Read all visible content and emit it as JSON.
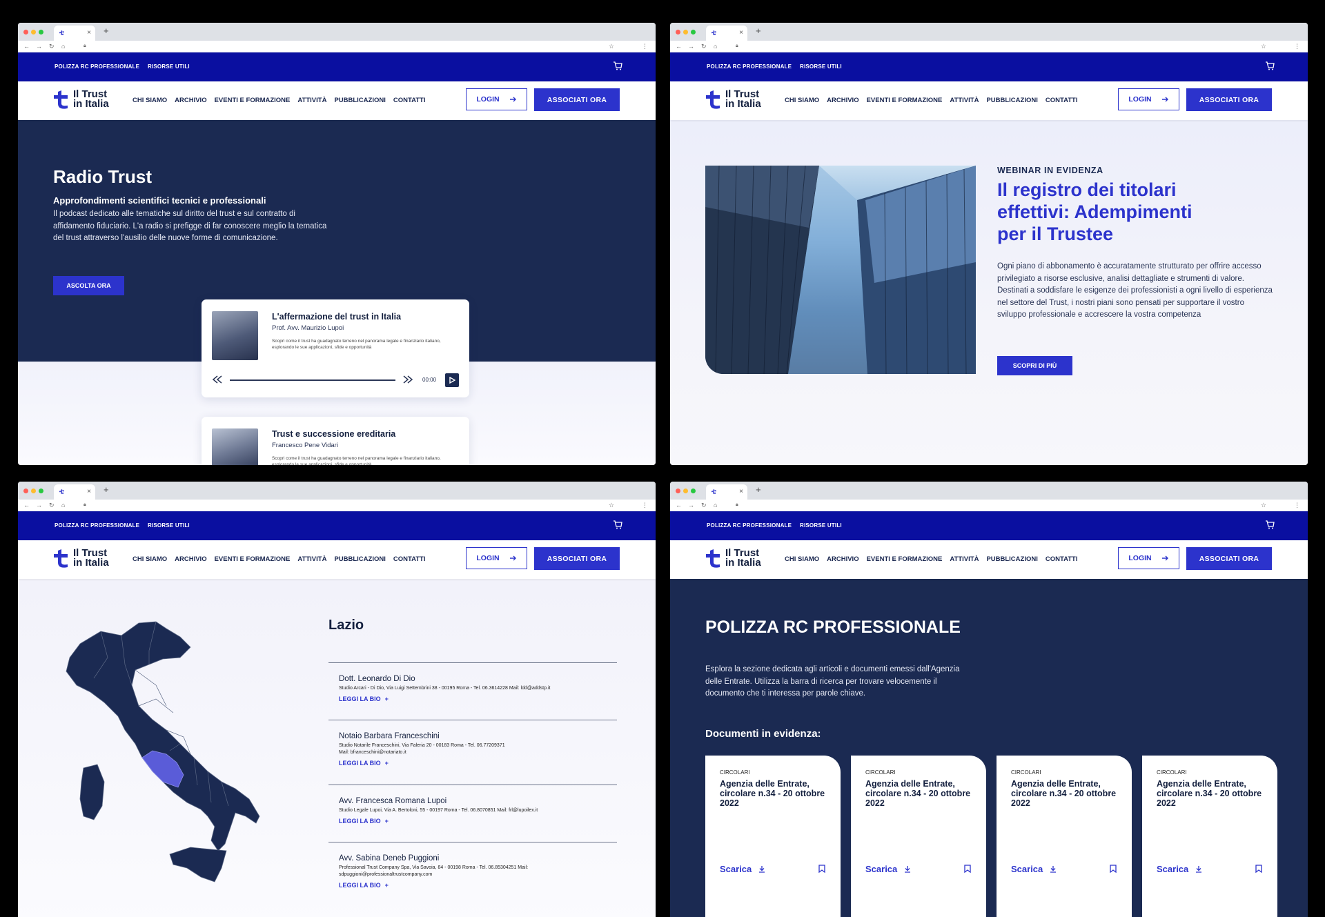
{
  "header": {
    "topbar_links": [
      "POLIZZA RC PROFESSIONALE",
      "RISORSE UTILI"
    ],
    "logo_line1": "Il Trust",
    "logo_line2": "in Italia",
    "nav": [
      "CHI SIAMO",
      "ARCHIVIO",
      "EVENTI E FORMAZIONE",
      "ATTIVITÀ",
      "PUBBLICAZIONI",
      "CONTATTI"
    ],
    "login": "LOGIN",
    "associati": "ASSOCIATI ORA"
  },
  "radio": {
    "title": "Radio Trust",
    "subtitle": "Approfondimenti scientifici tecnici e professionali",
    "description": "Il podcast dedicato alle tematiche sul diritto del trust e sul contratto di affidamento fiduciario. L'a radio si prefigge di far conoscere meglio la tematica del trust attraverso l'ausilio delle nuove forme di comunicazione.",
    "cta": "ASCOLTA ORA",
    "episodes": [
      {
        "title": "L'affermazione del trust in Italia",
        "author": "Prof. Avv. Maurizio Lupoi",
        "description": "Scopri come il trust ha guadagnato terreno nel panorama legale e finanziario italiano, esplorando le sue applicazioni, sfide e opportunità",
        "time": "00:00"
      },
      {
        "title": "Trust e successione ereditaria",
        "author": "Francesco Pene Vidari",
        "description": "Scopri come il trust ha guadagnato terreno nel panorama legale e finanziario italiano, esplorando le sue applicazioni, sfide e opportunità"
      }
    ]
  },
  "webinar": {
    "kicker": "WEBINAR IN EVIDENZA",
    "title": "Il registro dei titolari effettivi: Adempimenti per il Trustee",
    "description": "Ogni piano di abbonamento è accuratamente strutturato per offrire accesso privilegiato a risorse esclusive, analisi dettagliate e strumenti di valore. Destinati a soddisfare le esigenze dei professionisti a ogni livello di esperienza nel settore del Trust, i nostri piani sono pensati per supportare il vostro sviluppo professionale e accrescere la vostra competenza",
    "cta": "SCOPRI DI PIÙ"
  },
  "region": {
    "title": "Lazio",
    "bio_label": "LEGGI LA BIO",
    "contacts": [
      {
        "name": "Dott. Leonardo Di Dio",
        "info": "Studio Arcari - Di Dio, Via Luigi Settembrini 38 - 00195 Roma - Tel. 06.3614228 Mail: ldd@addstp.it"
      },
      {
        "name": "Notaio Barbara Franceschini",
        "info": "Studio Notarile Franceschini, Via Faleria 20 - 00183 Roma - Tel. 06.77209371",
        "info2": "Mail: bfranceschini@notariato.it"
      },
      {
        "name": "Avv. Francesca Romana Lupoi",
        "info": "Studio Legale Lupoi, Via A. Bertoloni, 55 - 00197 Roma - Tel. 06.8070851 Mail: frl@lupoilex.it"
      },
      {
        "name": "Avv. Sabina Deneb Puggioni",
        "info": "Professional Trust Company Spa, Via Savoia, 84 - 00198 Roma - Tel. 06.85304251 Mail:",
        "info2": "sdpuggioni@professionaltrustcompany.com"
      }
    ]
  },
  "polizza": {
    "title": "POLIZZA RC PROFESSIONALE",
    "description": "Esplora la sezione dedicata agli articoli e documenti emessi dall'Agenzia delle Entrate. Utilizza la barra di ricerca per trovare velocemente il documento che ti interessa per parole chiave.",
    "docs_heading": "Documenti in evidenza:",
    "docs": [
      {
        "tag": "CIRCOLARI",
        "title": "Agenzia delle Entrate, circolare n.34 - 20 ottobre 2022",
        "download": "Scarica"
      },
      {
        "tag": "CIRCOLARI",
        "title": "Agenzia delle Entrate, circolare n.34 - 20 ottobre 2022",
        "download": "Scarica"
      },
      {
        "tag": "CIRCOLARI",
        "title": "Agenzia delle Entrate, circolare n.34 - 20 ottobre 2022",
        "download": "Scarica"
      },
      {
        "tag": "CIRCOLARI",
        "title": "Agenzia delle Entrate, circolare n.34 - 20 ottobre 2022",
        "download": "Scarica"
      }
    ]
  },
  "icons": [
    "back-icon",
    "forward-icon",
    "reload-icon",
    "home-icon",
    "lock-icon",
    "star-icon",
    "menu-icon",
    "cart-icon",
    "arrow-right-icon",
    "rewind-icon",
    "fast-forward-icon",
    "play-icon",
    "plus-icon",
    "download-icon",
    "bookmark-icon"
  ],
  "colors": {
    "primary": "#2c33cc",
    "topbar": "#0a0fa0",
    "navy": "#1b2a52",
    "highlight_region": "#5a5cd8"
  }
}
